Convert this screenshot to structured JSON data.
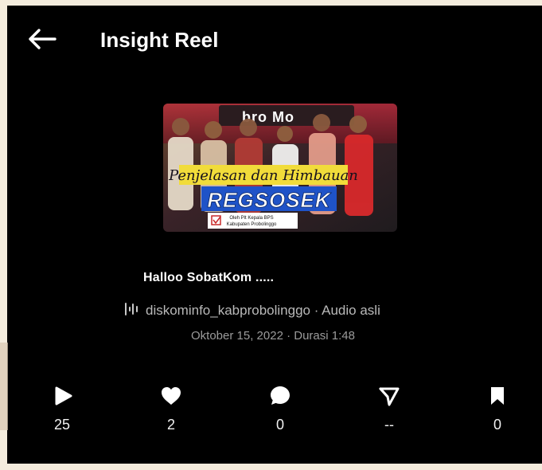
{
  "header": {
    "back_icon": "arrow-left-icon",
    "title": "Insight Reel"
  },
  "cover": {
    "top_logo": "bro Mo",
    "headline": "Penjelasan dan Himbauan",
    "program": "REGSOSEK",
    "byline_line1": "Oleh Plt Kepala BPS",
    "byline_line2": "Kabupaten Probolinggo"
  },
  "post": {
    "caption": "Halloo SobatKom .....",
    "audio_icon": "audio-waveform-icon",
    "audio_source": "diskominfo_kabprobolinggo · Audio asli",
    "meta": "Oktober 15, 2022 · Durasi 1:48"
  },
  "stats": [
    {
      "name": "plays",
      "icon": "play-icon",
      "count": "25"
    },
    {
      "name": "likes",
      "icon": "heart-icon",
      "count": "2"
    },
    {
      "name": "comments",
      "icon": "comment-icon",
      "count": "0"
    },
    {
      "name": "shares",
      "icon": "share-icon",
      "count": "--"
    },
    {
      "name": "saves",
      "icon": "bookmark-icon",
      "count": "0"
    }
  ],
  "colors": {
    "background": "#000000",
    "text": "#ffffff",
    "secondary_text": "#b9b9b9",
    "tertiary_text": "#9b9b9b",
    "cover_banner_yellow": "#f1dc3a",
    "cover_banner_blue": "#2f64d8"
  }
}
